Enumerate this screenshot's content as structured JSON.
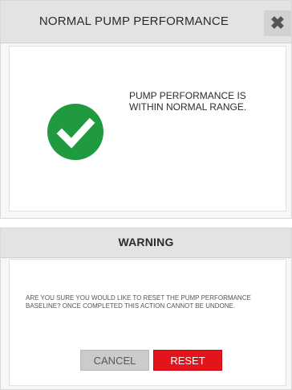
{
  "status_dialog": {
    "title": "NORMAL PUMP PERFORMANCE",
    "close_icon": "close-icon",
    "status_icon": "checkmark-circle-icon",
    "status_color": "#1f9a3f",
    "message": "PUMP PERFORMANCE IS WITHIN NORMAL RANGE."
  },
  "warning_dialog": {
    "title": "WARNING",
    "message": "ARE YOU SURE YOU WOULD LIKE TO RESET THE PUMP PERFORMANCE BASELINE? ONCE COMPLETED THIS ACTION CANNOT BE UNDONE.",
    "cancel_label": "CANCEL",
    "reset_label": "RESET",
    "reset_color": "#e3141b"
  }
}
